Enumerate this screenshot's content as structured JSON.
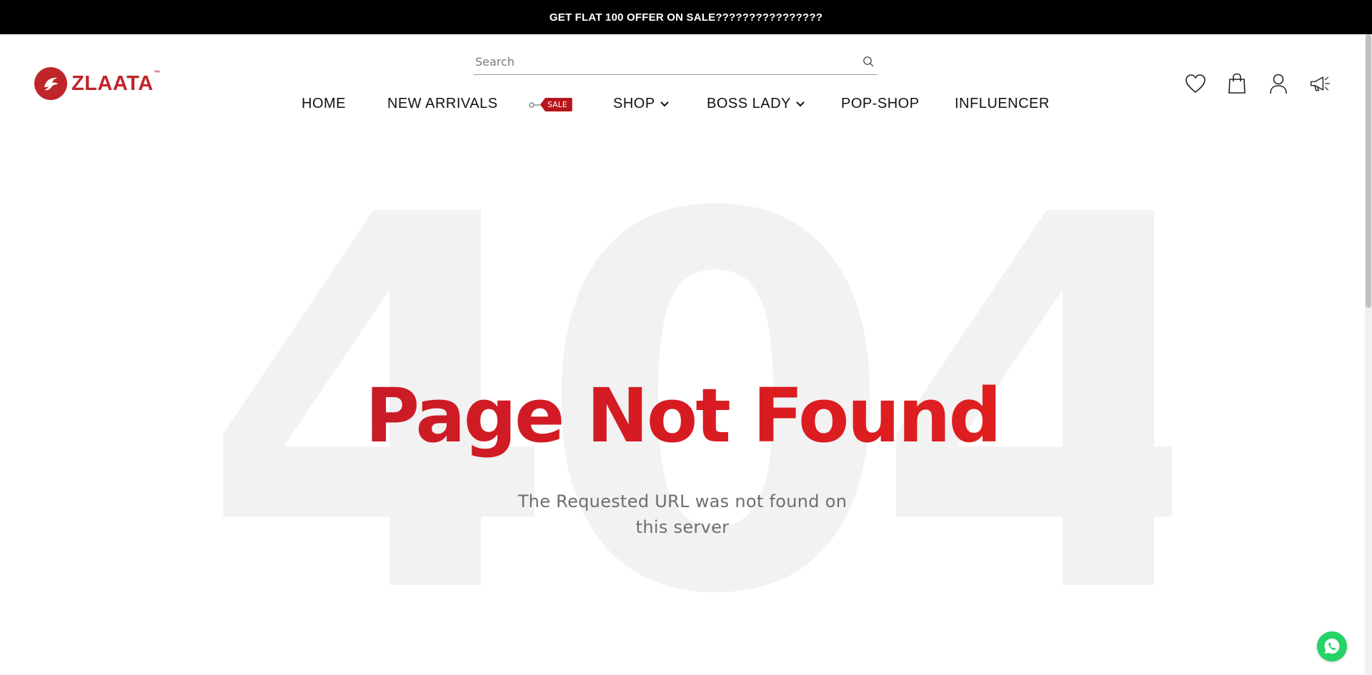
{
  "announcement": {
    "text": "GET FLAT 100 OFFER ON SALE????????????????"
  },
  "brand": {
    "name": "ZLAATA",
    "tm": "™",
    "color": "#c0252a"
  },
  "search": {
    "placeholder": "Search"
  },
  "nav": {
    "home": "HOME",
    "new_arrivals": "NEW ARRIVALS",
    "sale_badge": "SALE",
    "shop": "SHOP",
    "boss_lady": "BOSS LADY",
    "pop_shop": "POP-SHOP",
    "influencer": "INFLUENCER"
  },
  "header_icons": [
    "heart-icon",
    "shopping-bag-icon",
    "user-icon",
    "megaphone-icon"
  ],
  "error": {
    "background_code": "404",
    "headline": "Page Not Found",
    "message": "The Requested URL was not found on this server",
    "headline_colors": [
      "#b91c2a",
      "#e8231c"
    ]
  },
  "colors": {
    "announcement_bg": "#000000",
    "accent": "#c0252a",
    "whatsapp": "#25d366"
  }
}
